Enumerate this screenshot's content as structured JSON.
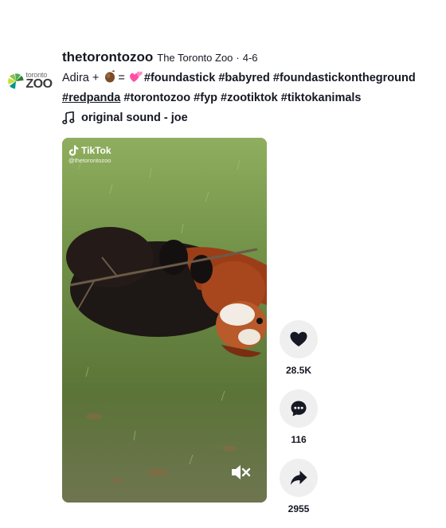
{
  "post": {
    "username": "thetorontozoo",
    "nickname": "The Toronto Zoo",
    "separator": "·",
    "date": "4-6",
    "avatar_logo": {
      "small": "toronto",
      "big": "ZOO"
    },
    "description": {
      "prefix": "Adira +",
      "equals": "=",
      "line1_tags": [
        "#foundastick",
        "#babyred",
        "#foundastickontheground"
      ],
      "line2_tags": [
        "#redpanda",
        "#torontozoo",
        "#fyp",
        "#zootiktok",
        "#tiktokanimals"
      ],
      "emojis": [
        "stick-emoji",
        "hearts-emoji"
      ]
    },
    "music": {
      "title": "original sound - joe",
      "icon": "music-note-icon"
    }
  },
  "video": {
    "watermark_brand": "TikTok",
    "watermark_handle": "@thetorontozoo",
    "mute_icon": "volume-muted-icon"
  },
  "actions": {
    "like": {
      "count": "28.5K",
      "icon": "heart-icon"
    },
    "comment": {
      "count": "116",
      "icon": "comment-icon"
    },
    "share": {
      "count": "2955",
      "icon": "share-icon"
    }
  }
}
